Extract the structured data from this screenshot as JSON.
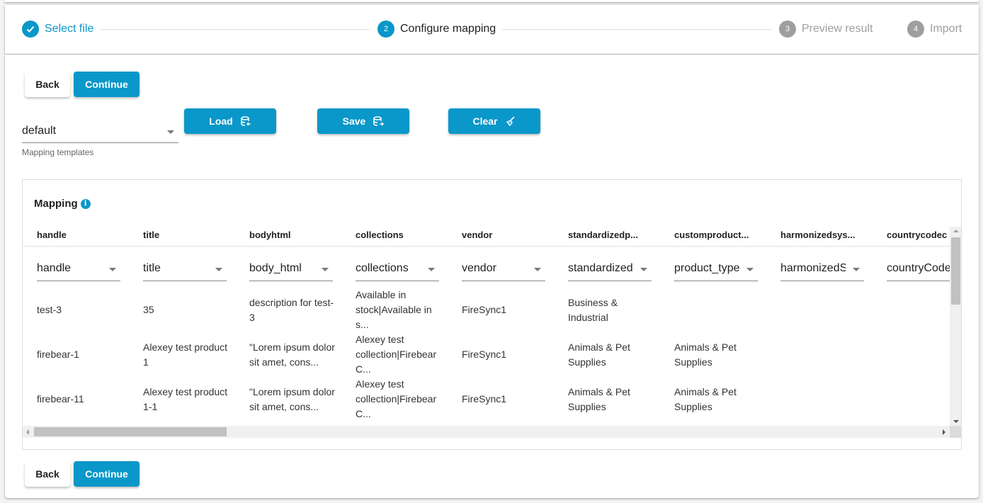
{
  "stepper": {
    "steps": [
      {
        "number": "1",
        "label": "Select file",
        "state": "done"
      },
      {
        "number": "2",
        "label": "Configure mapping",
        "state": "active"
      },
      {
        "number": "3",
        "label": "Preview result",
        "state": "todo"
      },
      {
        "number": "4",
        "label": "Import",
        "state": "todo"
      }
    ]
  },
  "actions": {
    "back_label": "Back",
    "continue_label": "Continue"
  },
  "templates": {
    "selected": "default",
    "helper": "Mapping templates",
    "load_label": "Load",
    "save_label": "Save",
    "clear_label": "Clear"
  },
  "mapping": {
    "title": "Mapping",
    "columns": [
      {
        "header": "handle",
        "mapped": "handle"
      },
      {
        "header": "title",
        "mapped": "title"
      },
      {
        "header": "bodyhtml",
        "mapped": "body_html"
      },
      {
        "header": "collections",
        "mapped": "collections"
      },
      {
        "header": "vendor",
        "mapped": "vendor"
      },
      {
        "header": "standardizedp...",
        "mapped": "standardized"
      },
      {
        "header": "customproduct...",
        "mapped": "product_type"
      },
      {
        "header": "harmonizedsys...",
        "mapped": "harmonizedS"
      },
      {
        "header": "countrycodec",
        "mapped": "countryCode"
      }
    ],
    "rows": [
      [
        "test-3",
        "35",
        "description for test-3",
        "Available in stock|Available in s...",
        "FireSync1",
        "Business & Industrial",
        "",
        "",
        ""
      ],
      [
        "firebear-1",
        "Alexey test product 1",
        "\"Lorem ipsum dolor sit amet, cons...",
        "Alexey test collection|Firebear C...",
        "FireSync1",
        "Animals & Pet Supplies",
        "Animals & Pet Supplies",
        "",
        ""
      ],
      [
        "firebear-11",
        "Alexey test product 1-1",
        "\"Lorem ipsum dolor sit amet, cons...",
        "Alexey test collection|Firebear C...",
        "FireSync1",
        "Animals & Pet Supplies",
        "Animals & Pet Supplies",
        "",
        ""
      ]
    ]
  }
}
